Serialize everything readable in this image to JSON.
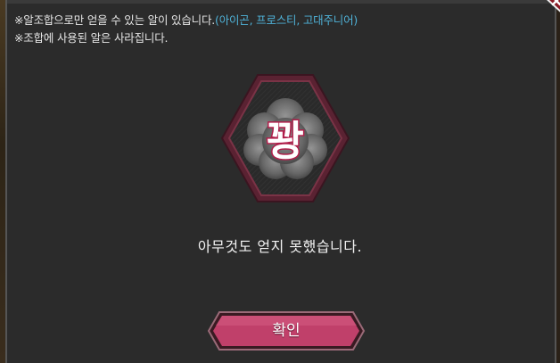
{
  "notes": {
    "line1_prefix": "※알조합으로만 얻을 수 있는 알이 있습니다.",
    "line1_highlight": "(아이곤, 프로스티, 고대주니어)",
    "line2": "※조합에 사용된 알은 사라집니다."
  },
  "result": {
    "badge_text": "꽝",
    "message": "아무것도 얻지 못했습니다."
  },
  "confirm_button": {
    "label": "확인"
  },
  "colors": {
    "highlight": "#4fb2d8",
    "button": "#c0406a",
    "badge_border": "#6e2a3c"
  }
}
